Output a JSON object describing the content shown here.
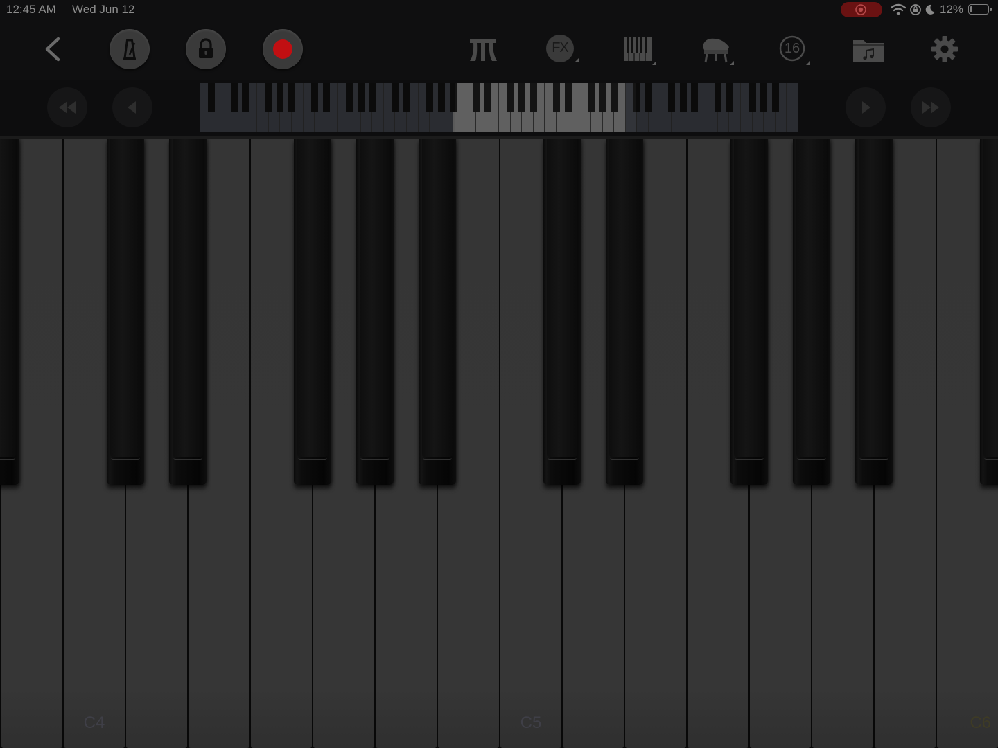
{
  "status_bar": {
    "time": "12:45 AM",
    "date": "Wed Jun 12",
    "battery_percent": "12%",
    "battery_level": 0.12,
    "screen_recording_active": true,
    "icons": [
      "screen-record-icon",
      "wifi-icon",
      "orientation-lock-icon",
      "moon-icon",
      "battery-icon"
    ]
  },
  "toolbar": {
    "left": [
      "back-icon",
      "metronome-icon",
      "lock-icon",
      "record-icon"
    ],
    "right": [
      "sustain-pedal-icon",
      "fx-icon",
      "keyboard-layout-icon",
      "instrument-icon",
      "channel-16-icon",
      "song-folder-icon",
      "settings-icon"
    ],
    "fx_label": "FX",
    "channel_label": "16",
    "record_color": "#c10f12"
  },
  "navigation": {
    "icons": [
      "rewind-octave-icon",
      "step-left-icon",
      "step-right-icon",
      "fast-forward-octave-icon"
    ]
  },
  "keyboard": {
    "visible_octaves": "C4 – C6",
    "labels": {
      "c4": "C4",
      "c5": "C5",
      "c6": "C6"
    },
    "label_color": "#3f3f47",
    "c6_label_color": "#3e3b25"
  }
}
